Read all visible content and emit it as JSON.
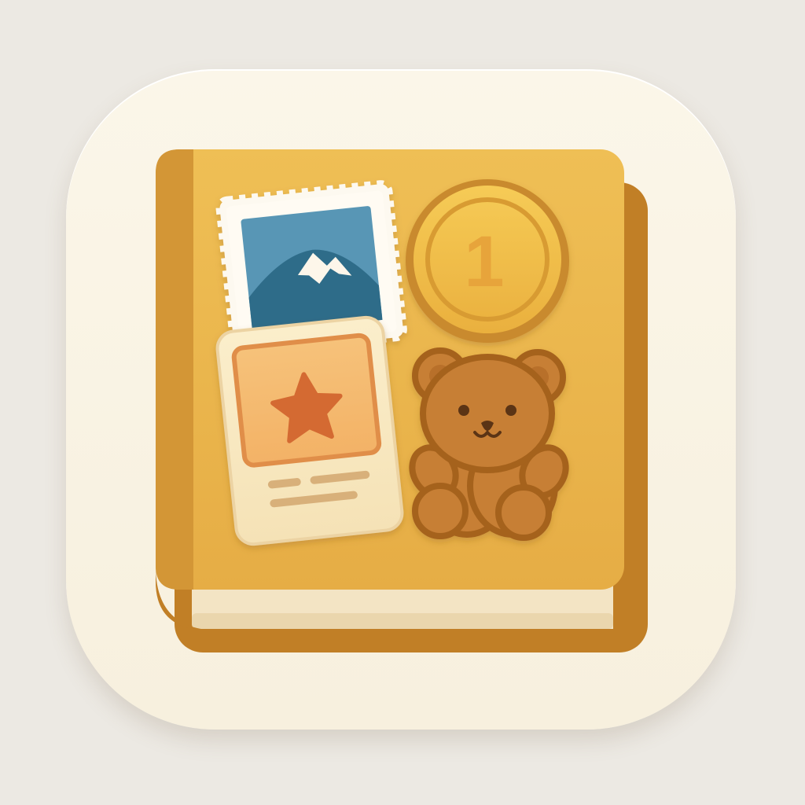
{
  "app_icon": {
    "subject": "collection-album",
    "colors": {
      "background": "#ece9e3",
      "tile": "#f8f1e1",
      "book_cover": "#eab54a",
      "book_spine": "#d09134",
      "book_back": "#c17f26",
      "pages": "#f3e4c4",
      "stamp_sky": "#5896b5",
      "stamp_mountain": "#2f6c89",
      "coin": "#f0bd45",
      "coin_rim": "#c98a2d",
      "card": "#f7e6be",
      "star": "#d46a32",
      "bear": "#c77f34",
      "bear_outline": "#a5621f"
    },
    "coin": {
      "label": "1"
    },
    "items": {
      "stamp": "mountain-stamp-icon",
      "coin": "coin-icon",
      "card": "star-card-icon",
      "bear": "teddy-bear-icon"
    }
  }
}
